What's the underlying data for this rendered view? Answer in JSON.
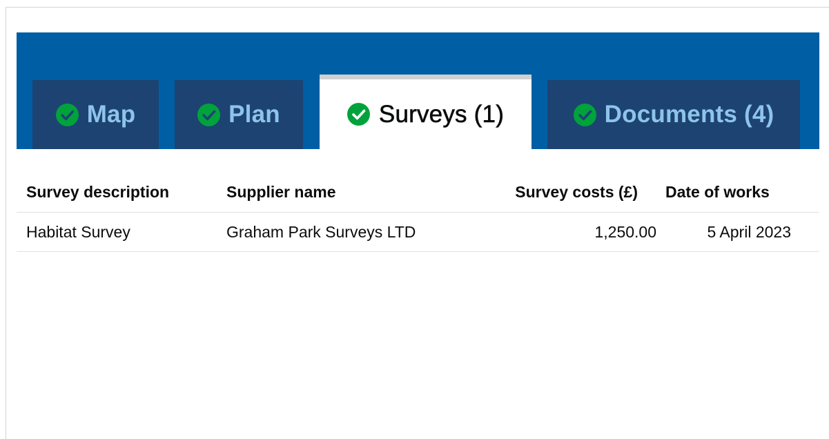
{
  "tabs": [
    {
      "id": "map",
      "label": "Map",
      "icon": "check-circle-icon",
      "completed": true,
      "active": false
    },
    {
      "id": "plan",
      "label": "Plan",
      "icon": "check-circle-icon",
      "completed": true,
      "active": false
    },
    {
      "id": "surveys",
      "label": "Surveys (1)",
      "icon": "check-circle-icon",
      "completed": true,
      "active": true
    },
    {
      "id": "documents",
      "label": "Documents (4)",
      "icon": "check-circle-icon",
      "completed": true,
      "active": false
    }
  ],
  "table": {
    "headers": [
      "Survey description",
      "Supplier name",
      "Survey costs (£)",
      "Date of works"
    ],
    "rows": [
      [
        "Habitat Survey",
        "Graham Park Surveys LTD",
        "1,250.00",
        "5 April 2023"
      ]
    ]
  },
  "colors": {
    "tab_bar": "#005ea5",
    "tab_inactive": "#1d4372",
    "tab_inactive_text": "#8ec4ec",
    "tab_active": "#ffffff",
    "check_green": "#00a33b"
  }
}
